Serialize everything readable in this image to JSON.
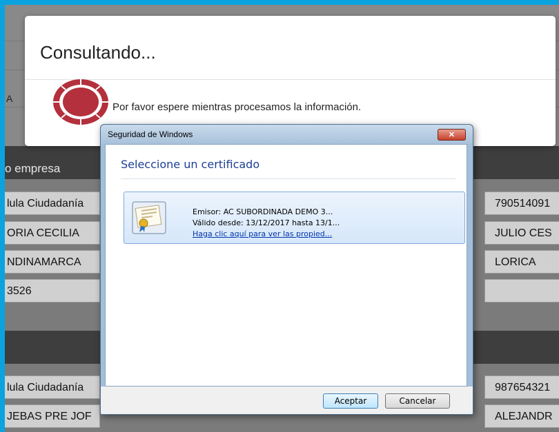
{
  "background": {
    "left_a": "A",
    "band1_label": "o empresa",
    "rows1": [
      {
        "left": "lula Ciudadanía",
        "right": "790514091"
      },
      {
        "left": "ORIA CECILIA",
        "right": "JULIO CES"
      },
      {
        "left": "NDINAMARCA",
        "right": "LORICA"
      },
      {
        "left": "3526",
        "right": ""
      }
    ],
    "rows2": [
      {
        "left": "lula Ciudadanía",
        "right": "987654321"
      },
      {
        "left": "JEBAS PRE JOF",
        "right": "ALEJANDR"
      }
    ]
  },
  "modal": {
    "title": "Consultando...",
    "message": "Por favor espere mientras procesamos la información.",
    "spinner_color": "#b3303c"
  },
  "dialog": {
    "window_title": "Seguridad de Windows",
    "close_glyph": "✕",
    "heading": "Seleccione un certificado",
    "certificate": {
      "issuer": "Emisor: AC SUBORDINADA DEMO 3...",
      "valid": "Válido desde: 13/12/2017 hasta 13/1...",
      "link": "Haga clic aquí para ver las propied..."
    },
    "accept": "Aceptar",
    "cancel": "Cancelar"
  }
}
